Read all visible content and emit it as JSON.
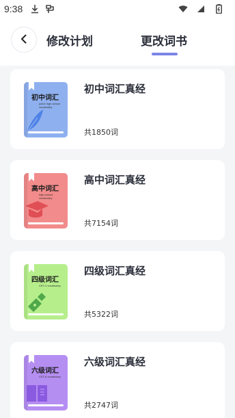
{
  "status_bar": {
    "time": "9:38"
  },
  "header": {
    "tab_plan": "修改计划",
    "tab_book": "更改词书"
  },
  "books": [
    {
      "cover_title": "初中词汇",
      "cover_sub": "junior high school vocabulary",
      "name": "初中词汇真经",
      "count": "共1850词",
      "color": "#8fb0ef",
      "art": "feather-icon"
    },
    {
      "cover_title": "高中词汇",
      "cover_sub": "high school vocabulary",
      "name": "高中词汇真经",
      "count": "共7154词",
      "color": "#f28b8b",
      "art": "graduation-cap-icon"
    },
    {
      "cover_title": "四级词汇",
      "cover_sub": "CET-4 vocabulary",
      "name": "四级词汇真经",
      "count": "共5322词",
      "color": "#b6ee8c",
      "art": "pen-nib-icon"
    },
    {
      "cover_title": "六级词汇",
      "cover_sub": "CET-6 vocabulary",
      "name": "六级词汇真经",
      "count": "共2747词",
      "color": "#b58ef2",
      "art": "open-book-icon"
    }
  ]
}
